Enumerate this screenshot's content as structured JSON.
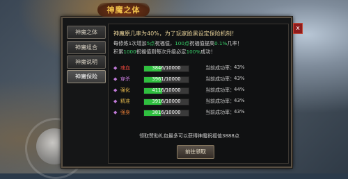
{
  "window": {
    "title": "神魔之体",
    "close": "x"
  },
  "tabs": [
    {
      "label": "神魔之体"
    },
    {
      "label": "神魔组合"
    },
    {
      "label": "神魔说明"
    },
    {
      "label": "神魔保险"
    }
  ],
  "active_tab": 3,
  "info": {
    "title": "神魔原几率为40%，为了玩家脸黑设定保险机制！",
    "line1_a": "每修炼1次增加",
    "line1_b": "5点",
    "line1_c": "祝福值，",
    "line1_d": "100点",
    "line1_e": "祝福值提高",
    "line1_f": "0.1%",
    "line1_g": "几率！",
    "line2_a": "积累",
    "line2_b": "1000",
    "line2_c": "祝福值则每次升级必定",
    "line2_d": "100%",
    "line2_e": "成功！"
  },
  "rows": [
    {
      "label": "魂血",
      "label_color": "#e2453b",
      "progress": "3846/10000",
      "fill": 0.3846,
      "rate_label": "当前成功率：",
      "rate": "43%"
    },
    {
      "label": "穿杀",
      "label_color": "#c47ad8",
      "progress": "3961/10000",
      "fill": 0.3961,
      "rate_label": "当前成功率：",
      "rate": "43%"
    },
    {
      "label": "强化",
      "label_color": "#e4b64c",
      "progress": "4116/10000",
      "fill": 0.4116,
      "rate_label": "当前成功率：",
      "rate": "44%"
    },
    {
      "label": "精准",
      "label_color": "#d8b04a",
      "progress": "3916/10000",
      "fill": 0.3916,
      "rate_label": "当前成功率：",
      "rate": "43%"
    },
    {
      "label": "强身",
      "label_color": "#e07a35",
      "progress": "3816/10000",
      "fill": 0.3816,
      "rate_label": "当前成功率：",
      "rate": "43%"
    }
  ],
  "footer": {
    "text": "领取赞助礼包最多可以获得神魔祝福值3888点",
    "button": "前往领取"
  },
  "colors": {
    "accent_green": "#38d16a",
    "accent_red": "#e2453b",
    "title_gold": "#f1c24b"
  },
  "icons": {
    "row_marker": "diamond-icon",
    "joystick": "joystick-icon"
  }
}
